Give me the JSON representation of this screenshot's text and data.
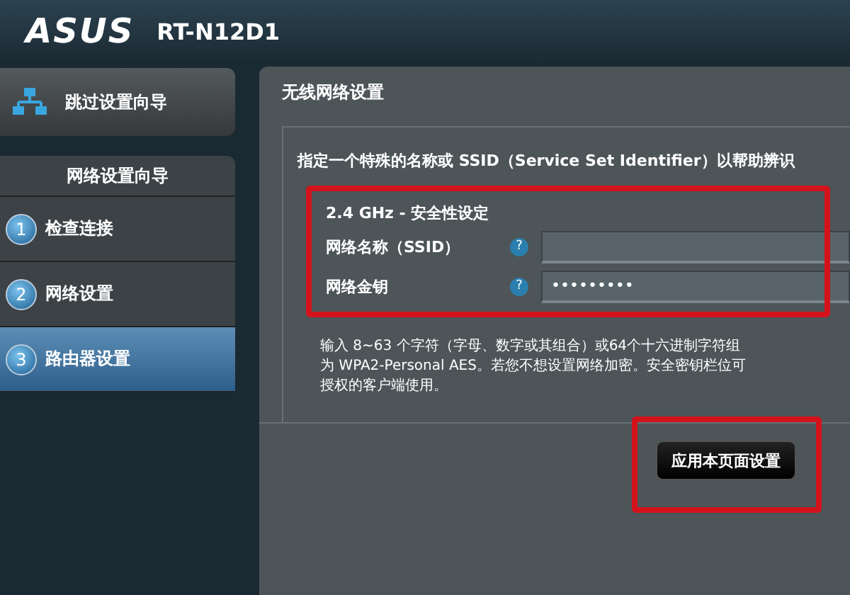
{
  "header": {
    "brand": "ASUS",
    "model": "RT-N12D1"
  },
  "sidebar": {
    "skip_button": "跳过设置向导",
    "wizard_title": "网络设置向导",
    "steps": [
      {
        "number": "1",
        "label": "检查连接",
        "selected": false
      },
      {
        "number": "2",
        "label": "网络设置",
        "selected": false
      },
      {
        "number": "3",
        "label": "路由器设置",
        "selected": true
      }
    ]
  },
  "panel": {
    "title": "无线网络设置",
    "instruction": "指定一个特殊的名称或 SSID（Service Set Identifier）以帮助辨识",
    "section_title": "2.4 GHz - 安全性设定",
    "fields": [
      {
        "label": "网络名称（SSID）",
        "help": "?"
      },
      {
        "label": "网络金钥",
        "help": "?",
        "value": "•••••••••"
      }
    ],
    "description_lines": [
      "输入 8~63 个字符（字母、数字或其组合）或64个十六进制字符组",
      "为 WPA2-Personal AES。若您不想设置网络加密。安全密钥栏位可",
      "授权的客户端使用。"
    ],
    "apply_button": "应用本页面设置"
  }
}
